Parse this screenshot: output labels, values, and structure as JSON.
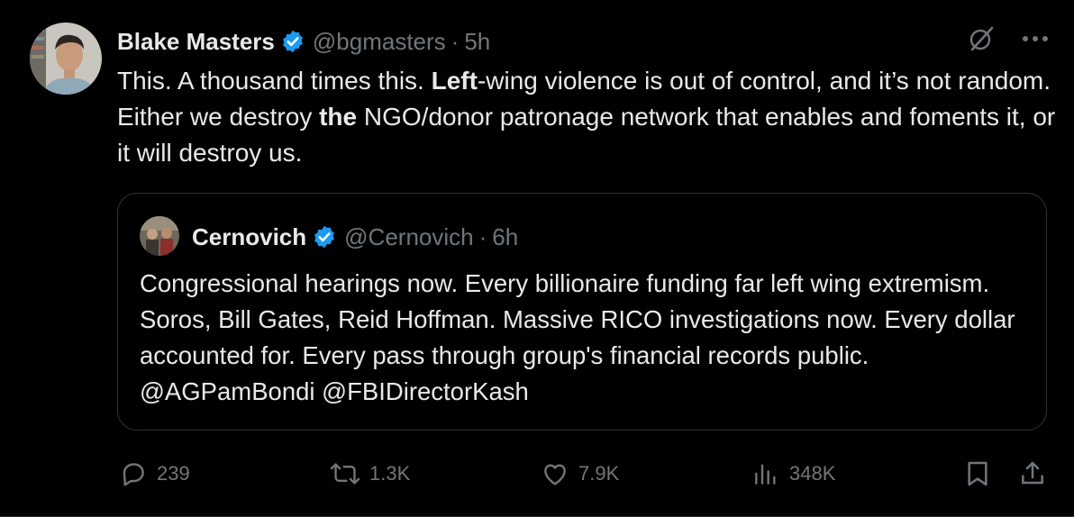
{
  "tweet": {
    "author_name": "Blake Masters",
    "handle": "@bgmasters",
    "separator": "·",
    "time": "5h",
    "text_parts": [
      "This. A thousand times this. ",
      "Left",
      "-wing violence is out of control, and it’s not random. Either we destroy ",
      "the",
      " NGO/donor patronage network that enables and foments it, or it will destroy us."
    ]
  },
  "quote": {
    "author_name": "Cernovich",
    "handle": "@Cernovich",
    "separator": "·",
    "time": "6h",
    "text": "Congressional hearings now. Every billionaire funding far left wing extremism. Soros, Bill Gates, Reid Hoffman. Massive RICO investigations now. Every dollar accounted for. Every pass through group's financial records public.  @AGPamBondi @FBIDirectorKash"
  },
  "actions": {
    "replies": "239",
    "reposts": "1.3K",
    "likes": "7.9K",
    "views": "348K"
  },
  "colors": {
    "background": "#000000",
    "text": "#e7e9ea",
    "muted": "#71767b",
    "verified": "#1d9bf0",
    "border": "#2f3336"
  },
  "icons": {
    "verified": "verified-badge-icon",
    "grok": "grok-icon",
    "more": "more-icon",
    "reply": "reply-icon",
    "repost": "repost-icon",
    "like": "like-icon",
    "views": "views-icon",
    "bookmark": "bookmark-icon",
    "share": "share-icon"
  }
}
